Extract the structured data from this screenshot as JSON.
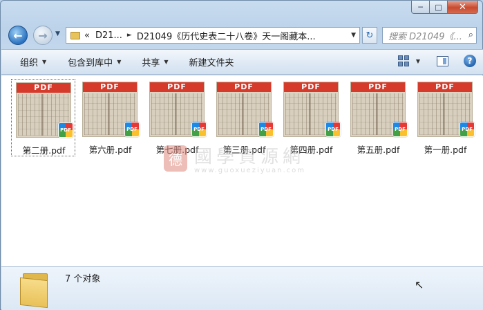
{
  "window": {
    "minimize_glyph": "─",
    "maximize_glyph": "□",
    "close_glyph": "✕"
  },
  "nav": {
    "back_glyph": "←",
    "forward_glyph": "→",
    "address": {
      "overflow_glyph": "«",
      "crumb1": "D21...",
      "crumb2": "D21049《历代史表二十八卷》天一阁藏本...",
      "sep_glyph": "►",
      "drop_glyph": "▼"
    },
    "refresh_glyph": "↻",
    "search_placeholder": "搜索 D21049《...",
    "search_icon": "⌕"
  },
  "toolbar": {
    "organize": "组织",
    "include_library": "包含到库中",
    "share": "共享",
    "new_folder": "新建文件夹",
    "arrow_glyph": "▼",
    "help_glyph": "?"
  },
  "files": [
    {
      "name": "第二册.pdf",
      "band": "PDF",
      "badge": "PDF"
    },
    {
      "name": "第六册.pdf",
      "band": "PDF",
      "badge": "PDF"
    },
    {
      "name": "第七册.pdf",
      "band": "PDF",
      "badge": "PDF"
    },
    {
      "name": "第三册.pdf",
      "band": "PDF",
      "badge": "PDF"
    },
    {
      "name": "第四册.pdf",
      "band": "PDF",
      "badge": "PDF"
    },
    {
      "name": "第五册.pdf",
      "band": "PDF",
      "badge": "PDF"
    },
    {
      "name": "第一册.pdf",
      "band": "PDF",
      "badge": "PDF"
    }
  ],
  "watermark": {
    "seal": "德",
    "text": "國學資源網",
    "url": "www.guoxueziyuan.com"
  },
  "status": {
    "count": "7 个对象",
    "cursor_glyph": "↖"
  }
}
